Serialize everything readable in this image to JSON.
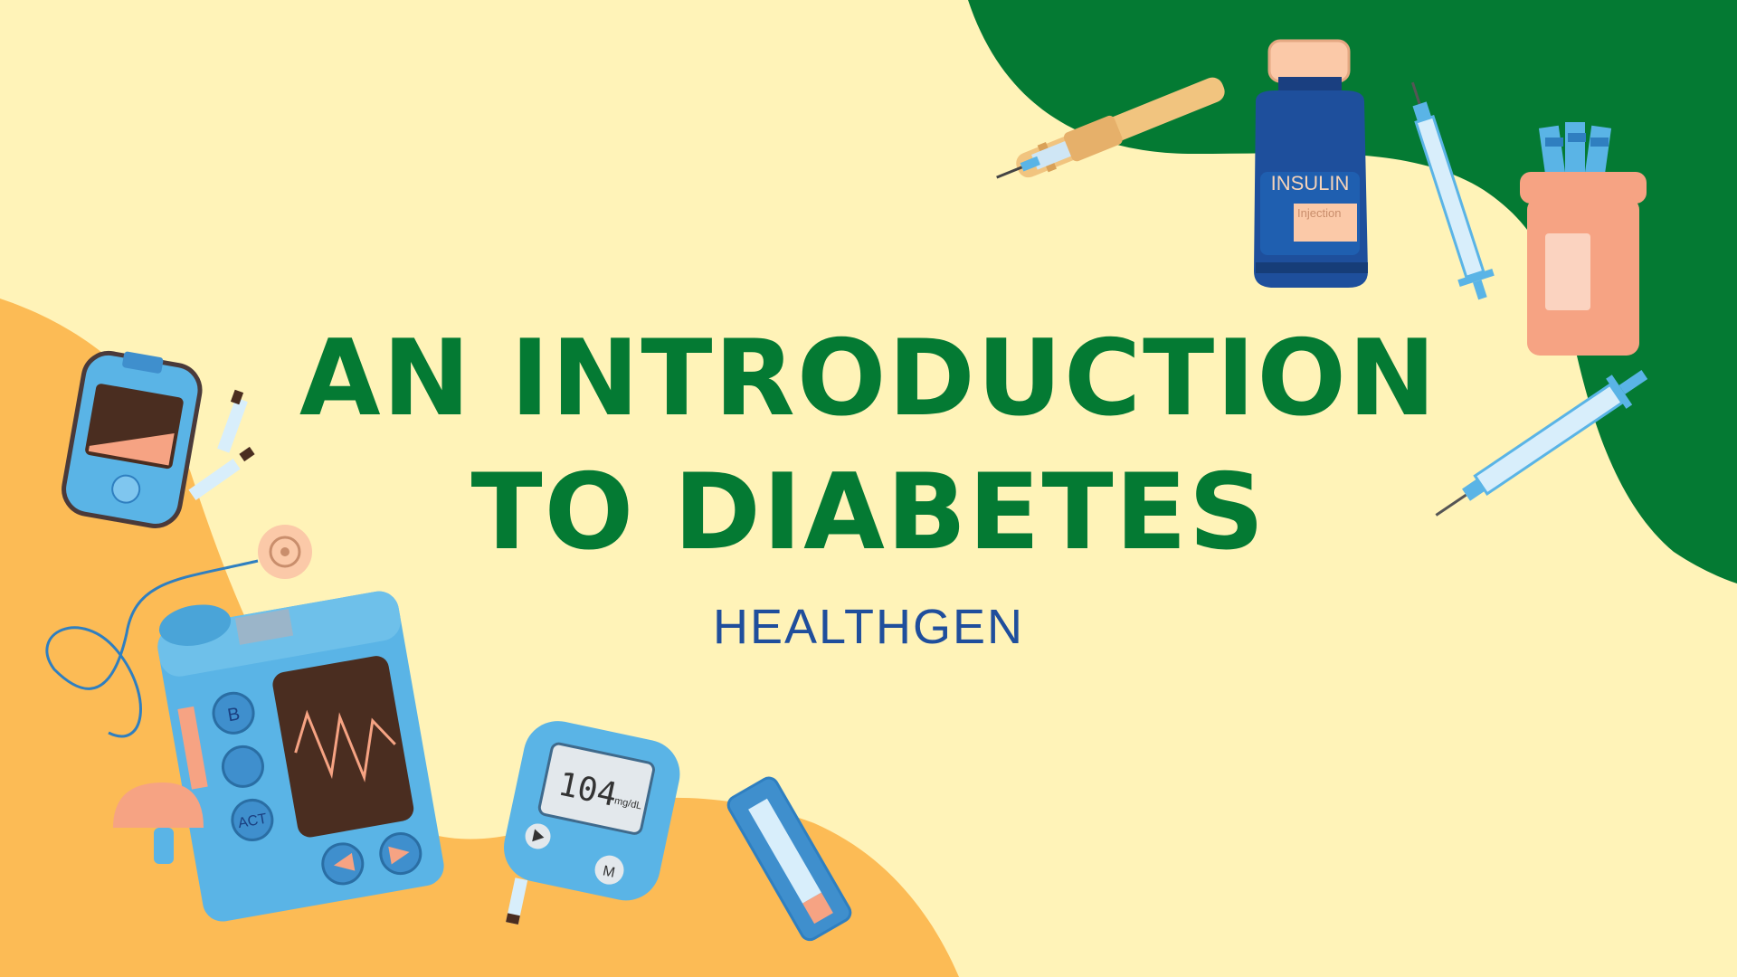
{
  "slide": {
    "title_line1": "AN INTRODUCTION",
    "title_line2": "TO DIABETES",
    "subtitle": "HEALTHGEN"
  },
  "illustrations": {
    "insulin_label": "INSULIN",
    "insulin_sub": "Injection",
    "meter_reading": "104",
    "meter_unit": "mg/dL",
    "pump_button_b": "B",
    "pump_button_act": "ACT",
    "meter_button_m": "M"
  },
  "colors": {
    "background": "#fff3b8",
    "green_blob": "#047a33",
    "orange_blob": "#fcbb55",
    "title": "#047a33",
    "subtitle": "#1f4e9c",
    "device_blue": "#5ab4e6",
    "bottle_blue": "#1e4f9c",
    "peach": "#f6a383"
  }
}
